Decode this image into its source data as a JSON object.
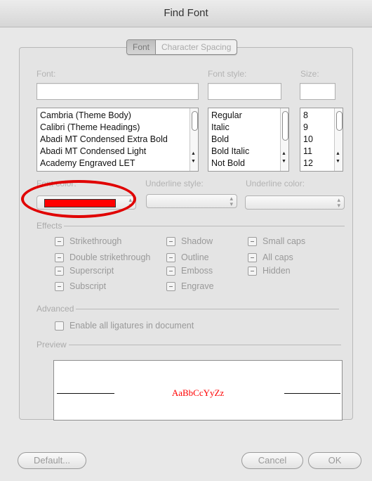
{
  "window": {
    "title": "Find Font"
  },
  "tabs": [
    {
      "label": "Font"
    },
    {
      "label": "Character Spacing"
    }
  ],
  "labels": {
    "font": "Font:",
    "font_style": "Font style:",
    "size": "Size:"
  },
  "font_list": [
    "Cambria (Theme Body)",
    "Calibri (Theme Headings)",
    "Abadi MT Condensed Extra Bold",
    "Abadi MT Condensed Light",
    "Academy Engraved LET"
  ],
  "style_list": [
    "Regular",
    "Italic",
    "Bold",
    "Bold Italic",
    "Not Bold"
  ],
  "size_list": [
    "8",
    "9",
    "10",
    "11",
    "12"
  ],
  "popups": {
    "font_color_label": "Font color:",
    "font_color_value": "#ff0000",
    "underline_style_label": "Underline style:",
    "underline_color_label": "Underline color:"
  },
  "effects": {
    "title": "Effects",
    "col1": [
      "Strikethrough",
      "Double strikethrough",
      "Superscript",
      "Subscript"
    ],
    "col2": [
      "Shadow",
      "Outline",
      "Emboss",
      "Engrave"
    ],
    "col3": [
      "Small caps",
      "All caps",
      "Hidden"
    ]
  },
  "advanced": {
    "title": "Advanced",
    "ligatures": "Enable all ligatures in document"
  },
  "preview": {
    "title": "Preview",
    "sample": "AaBbCcYyZz"
  },
  "buttons": {
    "default": "Default...",
    "cancel": "Cancel",
    "ok": "OK"
  },
  "colors": {
    "annotation": "#e00000",
    "preview_text": "#ff0000"
  }
}
